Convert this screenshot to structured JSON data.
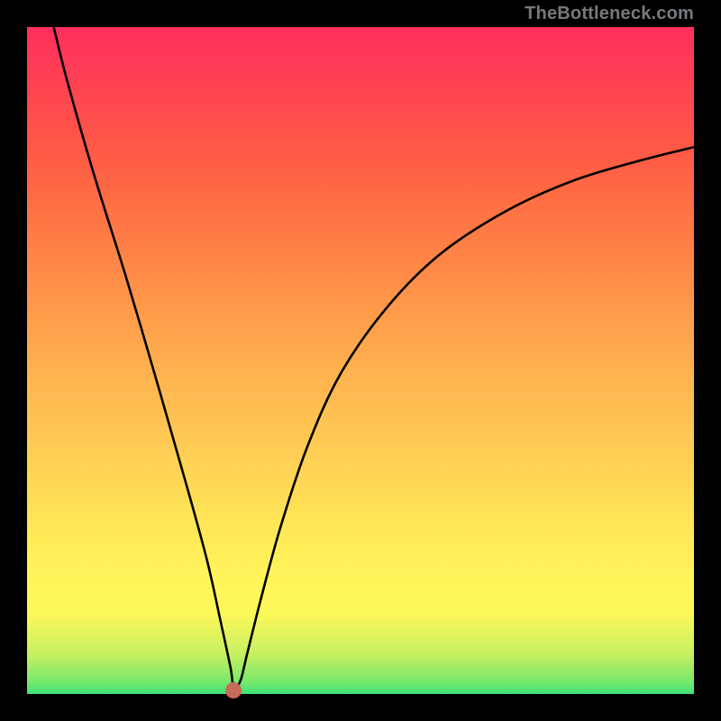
{
  "watermark": "TheBottleneck.com",
  "chart_data": {
    "type": "line",
    "title": "",
    "xlabel": "",
    "ylabel": "",
    "xlim": [
      0,
      100
    ],
    "ylim": [
      0,
      100
    ],
    "series": [
      {
        "name": "curve",
        "x": [
          4,
          6,
          10,
          15,
          20,
          24,
          27,
          29,
          30.5,
          31,
          32,
          33,
          35,
          38,
          42,
          47,
          54,
          62,
          72,
          82,
          92,
          100
        ],
        "y": [
          100,
          92,
          78,
          62,
          45,
          31,
          20,
          11,
          4,
          1,
          2,
          6,
          14,
          25,
          37,
          48,
          58,
          66,
          72.5,
          77,
          80,
          82
        ]
      }
    ],
    "marker": {
      "x": 31,
      "y": 0.5,
      "color": "#c96b59"
    },
    "grid": false,
    "legend": false,
    "background": "vertical-gradient green→yellow→red"
  }
}
